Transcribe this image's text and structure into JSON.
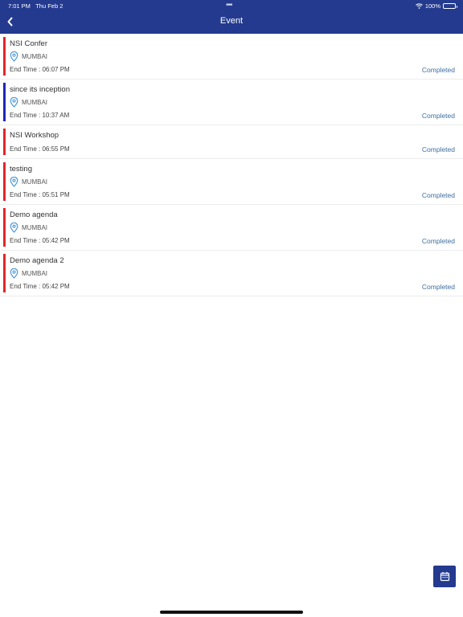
{
  "status_bar": {
    "time": "7:01 PM",
    "date": "Thu Feb 2",
    "battery": "100%"
  },
  "header": {
    "title": "Event"
  },
  "events": [
    {
      "title": "NSI Confer",
      "location": "MUMBAI",
      "end_time": "End Time : 06:07 PM",
      "status": "Completed",
      "accent": "#e0262c"
    },
    {
      "title": "since its inception",
      "location": "MUMBAI",
      "end_time": "End Time : 10:37 AM",
      "status": "Completed",
      "accent": "#1f27b8"
    },
    {
      "title": "NSI Workshop",
      "location": "",
      "end_time": "End Time : 06:55 PM",
      "status": "Completed",
      "accent": "#e0262c"
    },
    {
      "title": "testing",
      "location": "MUMBAI",
      "end_time": "End Time : 05:51 PM",
      "status": "Completed",
      "accent": "#e0262c"
    },
    {
      "title": "Demo agenda",
      "location": "MUMBAI",
      "end_time": "End Time : 05:42 PM",
      "status": "Completed",
      "accent": "#e0262c"
    },
    {
      "title": "Demo agenda 2",
      "location": "MUMBAI",
      "end_time": "End Time : 05:42 PM",
      "status": "Completed",
      "accent": "#e0262c"
    }
  ],
  "icons": {
    "back": "chevron-left-icon",
    "location": "location-pin-icon",
    "calendar": "calendar-icon",
    "wifi": "wifi-icon",
    "battery": "battery-icon"
  },
  "colors": {
    "header": "#233a8f",
    "status_text": "#3d6fa0"
  }
}
